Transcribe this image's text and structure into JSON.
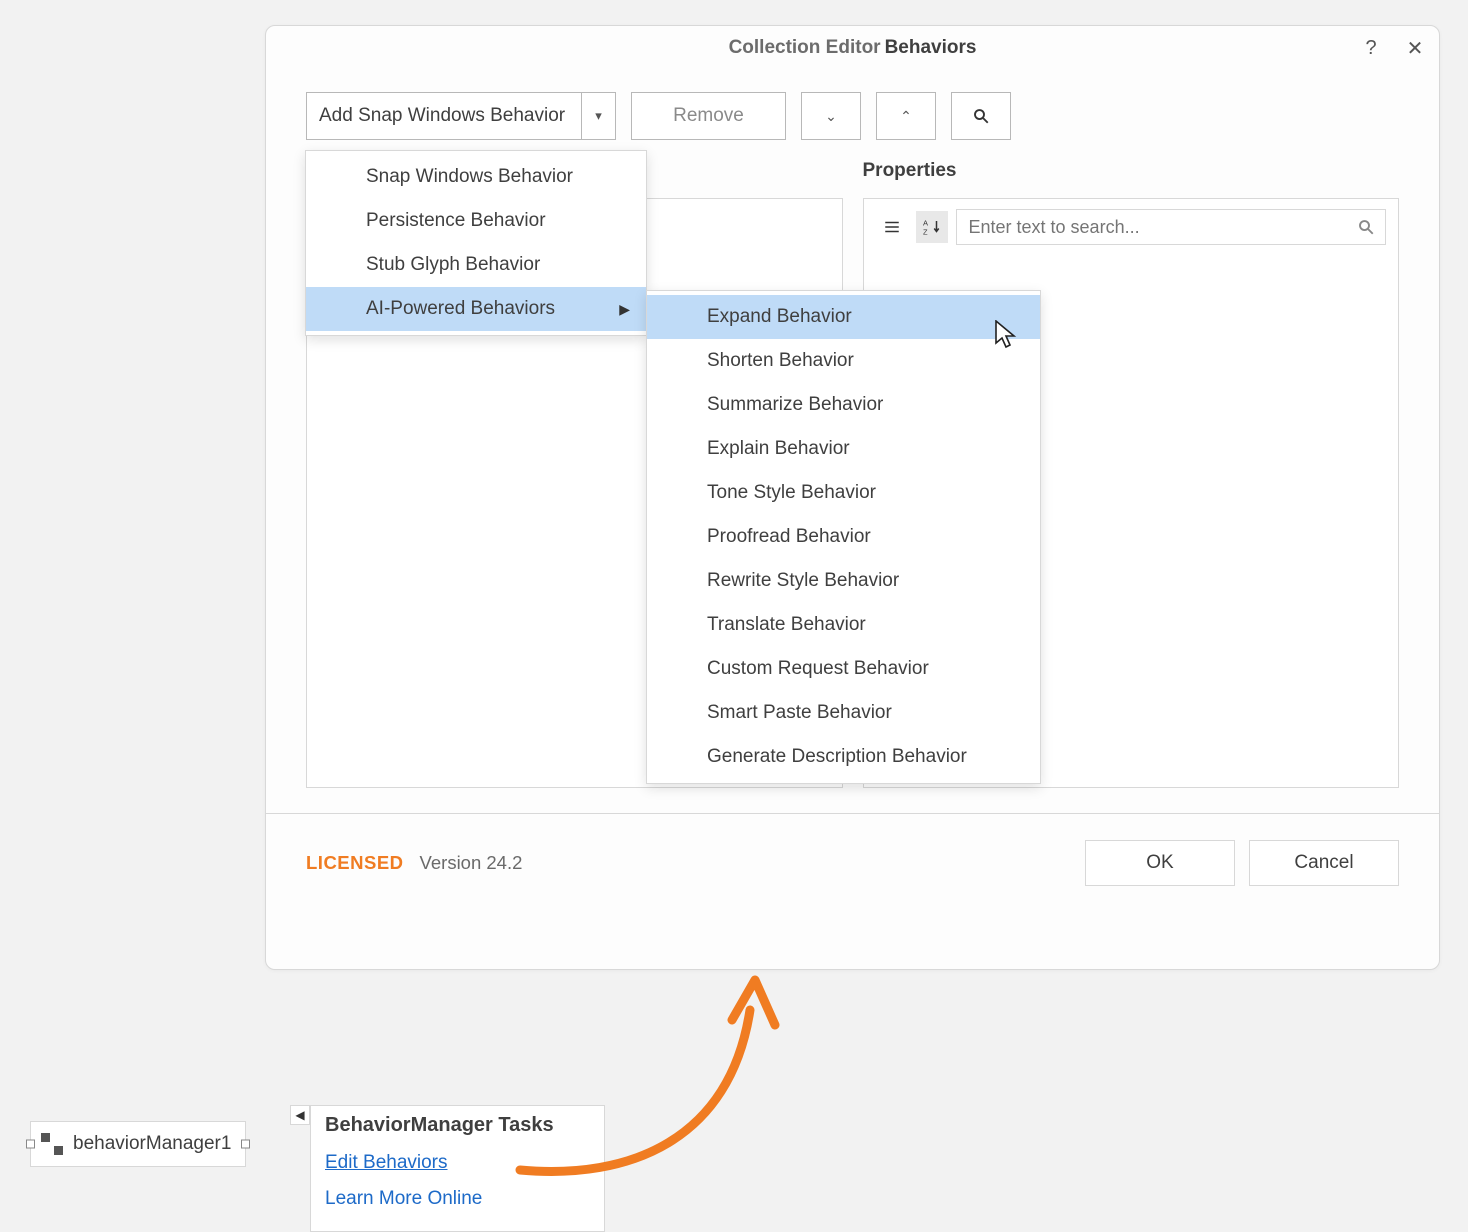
{
  "dialog": {
    "title_prefix": "Collection Editor",
    "title_main": "Behaviors",
    "help_glyph": "?",
    "close_glyph": "✕"
  },
  "toolbar": {
    "add_button_label": "Add Snap Windows Behavior",
    "remove_label": "Remove"
  },
  "panels": {
    "properties_label": "Properties",
    "search_placeholder": "Enter text to search..."
  },
  "menu_level1": [
    {
      "label": "Snap Windows Behavior",
      "highlight": false,
      "sub": false
    },
    {
      "label": "Persistence Behavior",
      "highlight": false,
      "sub": false
    },
    {
      "label": "Stub Glyph Behavior",
      "highlight": false,
      "sub": false
    },
    {
      "label": "AI-Powered Behaviors",
      "highlight": true,
      "sub": true
    }
  ],
  "menu_level2": [
    {
      "label": "Expand Behavior",
      "highlight": true
    },
    {
      "label": "Shorten Behavior",
      "highlight": false
    },
    {
      "label": "Summarize Behavior",
      "highlight": false
    },
    {
      "label": "Explain Behavior",
      "highlight": false
    },
    {
      "label": "Tone Style Behavior",
      "highlight": false
    },
    {
      "label": "Proofread Behavior",
      "highlight": false
    },
    {
      "label": "Rewrite Style Behavior",
      "highlight": false
    },
    {
      "label": "Translate Behavior",
      "highlight": false
    },
    {
      "label": "Custom Request Behavior",
      "highlight": false
    },
    {
      "label": "Smart Paste Behavior",
      "highlight": false
    },
    {
      "label": "Generate Description Behavior",
      "highlight": false
    }
  ],
  "footer": {
    "licensed_label": "LICENSED",
    "version_label": "Version 24.2",
    "ok_label": "OK",
    "cancel_label": "Cancel"
  },
  "designer": {
    "component_label": "behaviorManager1",
    "popup_title": "BehaviorManager Tasks",
    "edit_link": "Edit Behaviors",
    "learn_link": "Learn More Online",
    "handle_glyph": "◀"
  }
}
